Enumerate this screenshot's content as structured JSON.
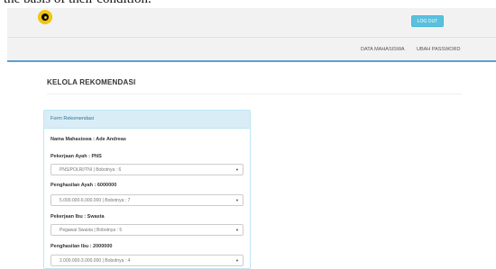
{
  "caption_fragment": "the basis of their condition.",
  "header": {
    "logout_label": "LOG OUT",
    "nav": [
      "DATA MAHASISWA",
      "UBAH PASSWORD"
    ]
  },
  "page_title": "KELOLA REKOMENDASI",
  "form": {
    "heading": "Form Rekomendasi",
    "student_name": "Nama Mahasiswa : Ade Andreas",
    "fields": [
      {
        "label": "Pekerjaan Ayah : PNS",
        "selected": "PNS/POLRI/TNI | Bobotnya : 6"
      },
      {
        "label": "Penghasilan Ayah : 6000000",
        "selected": "5.000.000-6.000.000 | Bobotnya : 7"
      },
      {
        "label": "Pekerjaan Ibu : Swasta",
        "selected": "Pegawai Swasta | Bobotnya : 5"
      },
      {
        "label": "Penghasilan Ibu : 2000000",
        "selected": "2.000.000-3.000.000 | Bobotnya : 4"
      }
    ]
  },
  "colors": {
    "accent": "#5a9fd4",
    "logout_button": "#5bc0de",
    "panel_heading": "#d9edf7",
    "logo": "#f1c40f"
  },
  "icons": {
    "logo": "university-logo",
    "dropdown": "caret-down-icon"
  }
}
